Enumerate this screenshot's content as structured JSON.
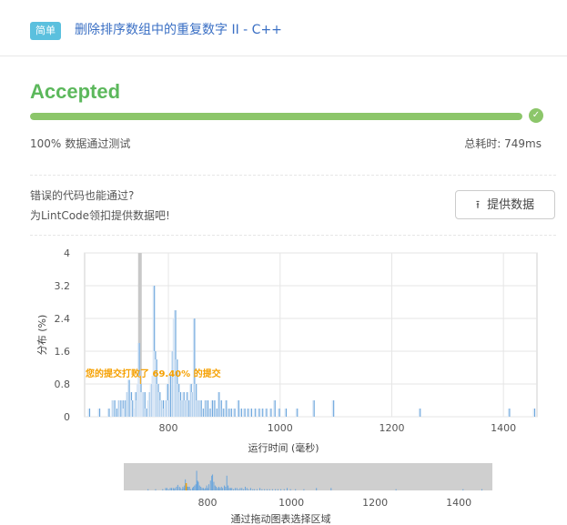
{
  "header": {
    "difficulty_tag": "简单",
    "problem_title": "删除排序数组中的重复数字 II",
    "language_suffix": " - C++"
  },
  "result": {
    "status": "Accepted",
    "progress_percent": 100,
    "pass_rate": "100%",
    "pass_label": "数据通过测试",
    "time_label": "总耗时: 749ms",
    "accent_color": "#5cb85c",
    "bar_color": "#8cc66a"
  },
  "contribute": {
    "line1": "错误的代码也能通过?",
    "line2": "为LintCode领扣提供数据吧!",
    "button_label": "提供数据",
    "button_icon": "upload-icon"
  },
  "chart_data": {
    "type": "bar",
    "xlabel": "运行时间 (毫秒)",
    "ylabel": "分布 (%)",
    "xlim": [
      650,
      1460
    ],
    "ylim": [
      0,
      4
    ],
    "xticks": [
      800,
      1000,
      1200,
      1400
    ],
    "yticks": [
      "0",
      "0.8",
      "1.6",
      "2.4",
      "3.2",
      "4"
    ],
    "marker_x": 749,
    "beat_text": "您的提交打败了 69.40% 的提交",
    "bars": [
      [
        658,
        0.2
      ],
      [
        676,
        0.2
      ],
      [
        693,
        0.2
      ],
      [
        700,
        0.4
      ],
      [
        703,
        0.4
      ],
      [
        707,
        0.2
      ],
      [
        711,
        0.4
      ],
      [
        714,
        0.4
      ],
      [
        718,
        0.4
      ],
      [
        720,
        0.2
      ],
      [
        722,
        0.4
      ],
      [
        726,
        0.6
      ],
      [
        729,
        0.9
      ],
      [
        733,
        0.6
      ],
      [
        735,
        0.4
      ],
      [
        739,
        0.2
      ],
      [
        741,
        0.6
      ],
      [
        744,
        0.4
      ],
      [
        745,
        0.8
      ],
      [
        747,
        1.8
      ],
      [
        749,
        1.0
      ],
      [
        750,
        0.8
      ],
      [
        752,
        0.6
      ],
      [
        754,
        0.6
      ],
      [
        757,
        0.6
      ],
      [
        760,
        0.2
      ],
      [
        764,
        0.4
      ],
      [
        766,
        0.6
      ],
      [
        769,
        0.8
      ],
      [
        772,
        1.0
      ],
      [
        774,
        3.2
      ],
      [
        776,
        1.6
      ],
      [
        778,
        1.4
      ],
      [
        781,
        0.8
      ],
      [
        784,
        0.6
      ],
      [
        787,
        0.4
      ],
      [
        790,
        0.4
      ],
      [
        793,
        0.2
      ],
      [
        795,
        0.4
      ],
      [
        798,
        0.8
      ],
      [
        800,
        0.4
      ],
      [
        803,
        1.0
      ],
      [
        807,
        1.6
      ],
      [
        810,
        2.4
      ],
      [
        812,
        2.6
      ],
      [
        815,
        1.4
      ],
      [
        818,
        0.8
      ],
      [
        821,
        0.6
      ],
      [
        824,
        0.4
      ],
      [
        827,
        0.6
      ],
      [
        830,
        0.4
      ],
      [
        833,
        0.6
      ],
      [
        836,
        0.4
      ],
      [
        840,
        0.8
      ],
      [
        843,
        0.6
      ],
      [
        846,
        2.4
      ],
      [
        849,
        0.8
      ],
      [
        852,
        0.4
      ],
      [
        855,
        0.4
      ],
      [
        858,
        0.4
      ],
      [
        862,
        0.2
      ],
      [
        866,
        0.4
      ],
      [
        870,
        0.4
      ],
      [
        874,
        0.2
      ],
      [
        878,
        0.4
      ],
      [
        882,
        0.4
      ],
      [
        886,
        0.2
      ],
      [
        890,
        0.6
      ],
      [
        894,
        0.4
      ],
      [
        898,
        0.2
      ],
      [
        903,
        0.4
      ],
      [
        908,
        0.2
      ],
      [
        912,
        0.2
      ],
      [
        918,
        0.2
      ],
      [
        925,
        0.4
      ],
      [
        930,
        0.2
      ],
      [
        936,
        0.2
      ],
      [
        942,
        0.2
      ],
      [
        948,
        0.2
      ],
      [
        955,
        0.2
      ],
      [
        962,
        0.2
      ],
      [
        968,
        0.2
      ],
      [
        975,
        0.2
      ],
      [
        983,
        0.2
      ],
      [
        990,
        0.4
      ],
      [
        998,
        0.2
      ],
      [
        1010,
        0.2
      ],
      [
        1030,
        0.2
      ],
      [
        1060,
        0.4
      ],
      [
        1095,
        0.4
      ],
      [
        1250,
        0.2
      ],
      [
        1410,
        0.2
      ],
      [
        1455,
        0.2
      ]
    ]
  },
  "navigator": {
    "caption": "通过拖动图表选择区域",
    "xlim": [
      600,
      1480
    ],
    "xticks": [
      800,
      1000,
      1200,
      1400
    ]
  }
}
